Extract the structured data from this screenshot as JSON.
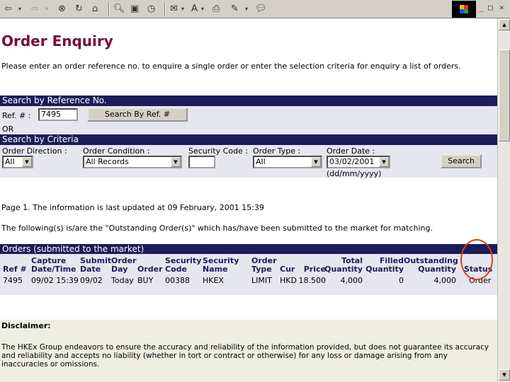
{
  "toolbar": {
    "icons": [
      "back-icon",
      "forward-icon",
      "stop-icon",
      "refresh-icon",
      "home-icon",
      "search-icon",
      "favorites-icon",
      "history-icon",
      "mail-icon",
      "font-icon",
      "print-icon",
      "edit-icon",
      "discuss-icon"
    ],
    "window_controls": [
      "_",
      "□",
      "×"
    ]
  },
  "page": {
    "title": "Order Enquiry",
    "intro": "Please enter an order reference no. to enquire a single order or enter the selection criteria for enquiry a list of orders."
  },
  "search_ref": {
    "header": "Search by Reference No.",
    "label": "Ref. # :",
    "value": "7495",
    "button": "Search By Ref. #",
    "or": "OR"
  },
  "search_criteria": {
    "header": "Search by Criteria",
    "direction_label": "Order Direction :",
    "direction_value": "All",
    "condition_label": "Order Condition :",
    "condition_value": "All Records",
    "security_label": "Security Code :",
    "security_value": "",
    "type_label": "Order Type :",
    "type_value": "All",
    "date_label": "Order Date :",
    "date_value": "03/02/2001",
    "date_hint": "(dd/mm/yyyy)",
    "button": "Search"
  },
  "info": {
    "updated": "Page 1. The information is last updated at 09 February, 2001 15:39",
    "outstanding": "The following(s) is/are the \"Outstanding Order(s)\" which has/have been submitted to the market for matching."
  },
  "orders": {
    "header": "Orders (submitted to the market)",
    "columns": {
      "ref": "Ref #",
      "capture_1": "Capture",
      "capture_2": "Date/Time",
      "submit_1": "Submit",
      "submit_2": "Date",
      "orderday_1": "Order",
      "orderday_2": "Day",
      "order": "Order",
      "seccode_1": "Security",
      "seccode_2": "Code",
      "secname_1": "Security",
      "secname_2": "Name",
      "type_1": "Order",
      "type_2": "Type",
      "cur": "Cur",
      "price": "Price",
      "total_1": "Total",
      "total_2": "Quantity",
      "filled_1": "Filled",
      "filled_2": "Quantity",
      "outstanding_1": "Outstanding",
      "outstanding_2": "Quantity",
      "status": "Status"
    },
    "row": {
      "ref": "7495",
      "capture": "09/02 15:39",
      "submit": "09/02",
      "day": "Today",
      "order": "BUY",
      "code": "00388",
      "name": "HKEX",
      "type": "LIMIT",
      "cur": "HKD",
      "price": "18.500",
      "total": "4,000",
      "filled": "0",
      "outstanding": "4,000",
      "status": "Order"
    }
  },
  "disclaimer": {
    "title": "Disclaimer:",
    "text": "The HKEx Group endeavors to ensure the accuracy and reliability of the information provided, but does not guarantee its accuracy and reliability and accepts no liability (whether in tort or contract or otherwise) for any loss or damage arising from any inaccuracies or omissions."
  },
  "colors": {
    "title": "#7a0a3c",
    "header_bar": "#1c1c5a",
    "panel": "#e6e6ee",
    "highlight_circle": "#e04010"
  }
}
